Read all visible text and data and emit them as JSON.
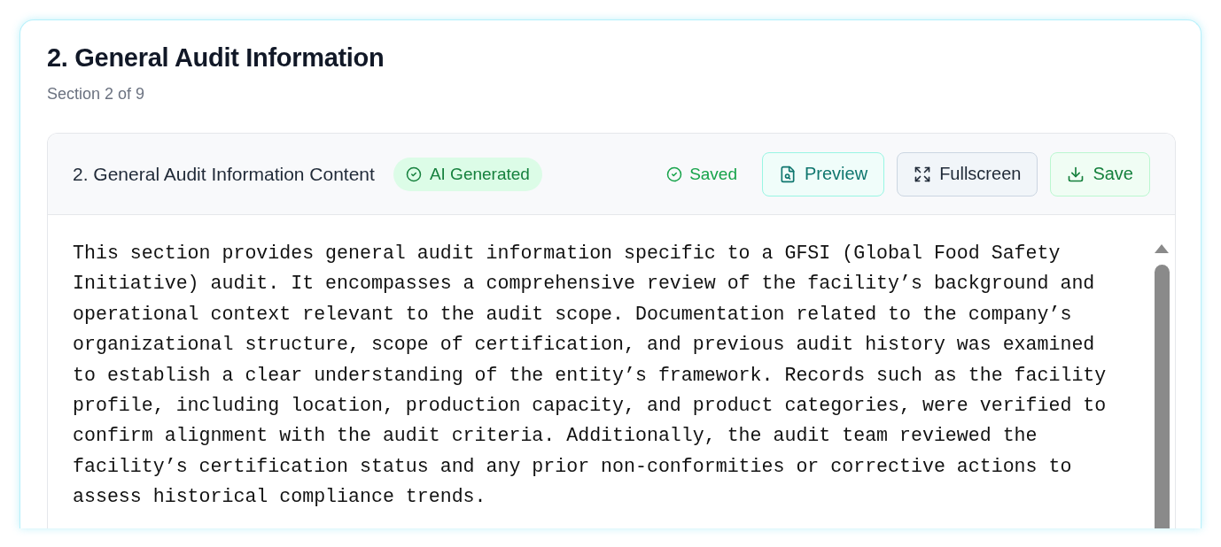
{
  "section": {
    "title": "2. General Audit Information",
    "subtitle": "Section 2 of 9"
  },
  "editor": {
    "title": "2. General Audit Information Content",
    "badge": "AI Generated",
    "status": "Saved",
    "buttons": [
      {
        "kind": "preview",
        "label": "Preview"
      },
      {
        "kind": "fullscreen",
        "label": "Fullscreen"
      },
      {
        "kind": "save",
        "label": "Save"
      }
    ],
    "content": "This section provides general audit information specific to a GFSI (Global Food Safety Initiative) audit. It encompasses a comprehensive review of the facility’s background and operational context relevant to the audit scope. Documentation related to the company’s organizational structure, scope of certification, and previous audit history was examined to establish a clear understanding of the entity’s framework. Records such as the facility profile, including location, production capacity, and product categories, were verified to confirm alignment with the audit criteria. Additionally, the audit team reviewed the facility’s certification status and any prior non-conformities or corrective actions to assess historical compliance trends."
  }
}
